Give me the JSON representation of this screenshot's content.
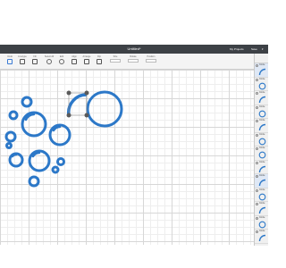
{
  "app": {
    "title": "Untitled*",
    "my_projects": "My Projects",
    "save": "Save",
    "caret": "▾"
  },
  "toolbar": {
    "tools": [
      {
        "name": "undo",
        "label": "Undo",
        "icon": "undo-icon"
      },
      {
        "name": "linetype",
        "label": "Linetype",
        "icon": "linetype-icon"
      },
      {
        "name": "fill",
        "label": "Fill",
        "icon": "fill-icon"
      },
      {
        "name": "select-all",
        "label": "Select All",
        "icon": "select-all-icon"
      },
      {
        "name": "edit",
        "label": "Edit",
        "icon": "edit-icon"
      },
      {
        "name": "align",
        "label": "Align",
        "icon": "align-icon"
      },
      {
        "name": "arrange",
        "label": "Arrange",
        "icon": "arrange-icon"
      },
      {
        "name": "flip",
        "label": "Flip",
        "icon": "flip-icon"
      },
      {
        "name": "size",
        "label": "Size",
        "icon": "size-field"
      },
      {
        "name": "rotate",
        "label": "Rotate",
        "icon": "rotate-field"
      },
      {
        "name": "position",
        "label": "Position",
        "icon": "position-field"
      }
    ]
  },
  "canvas": {
    "selection_label": "",
    "accent_color": "#2c78c8"
  },
  "layers_panel": {
    "header": "",
    "items": [
      {
        "name": "Circle",
        "shape": "arc",
        "active": true
      },
      {
        "name": "Circle",
        "shape": "circle",
        "active": false
      },
      {
        "name": "Circle",
        "shape": "arc",
        "active": false
      },
      {
        "name": "Circle",
        "shape": "circle",
        "active": false
      },
      {
        "name": "Circle",
        "shape": "arc",
        "active": false
      },
      {
        "name": "Circle",
        "shape": "circle",
        "active": false
      },
      {
        "name": "Circle",
        "shape": "circle",
        "active": false
      },
      {
        "name": "Circle",
        "shape": "arc",
        "active": false
      },
      {
        "name": "Circle",
        "shape": "arc",
        "active": true
      },
      {
        "name": "Circle",
        "shape": "circle",
        "active": false
      },
      {
        "name": "Circle",
        "shape": "arc",
        "active": false
      },
      {
        "name": "Circle",
        "shape": "circle",
        "active": false
      },
      {
        "name": "Circle",
        "shape": "arc",
        "active": false
      }
    ]
  }
}
